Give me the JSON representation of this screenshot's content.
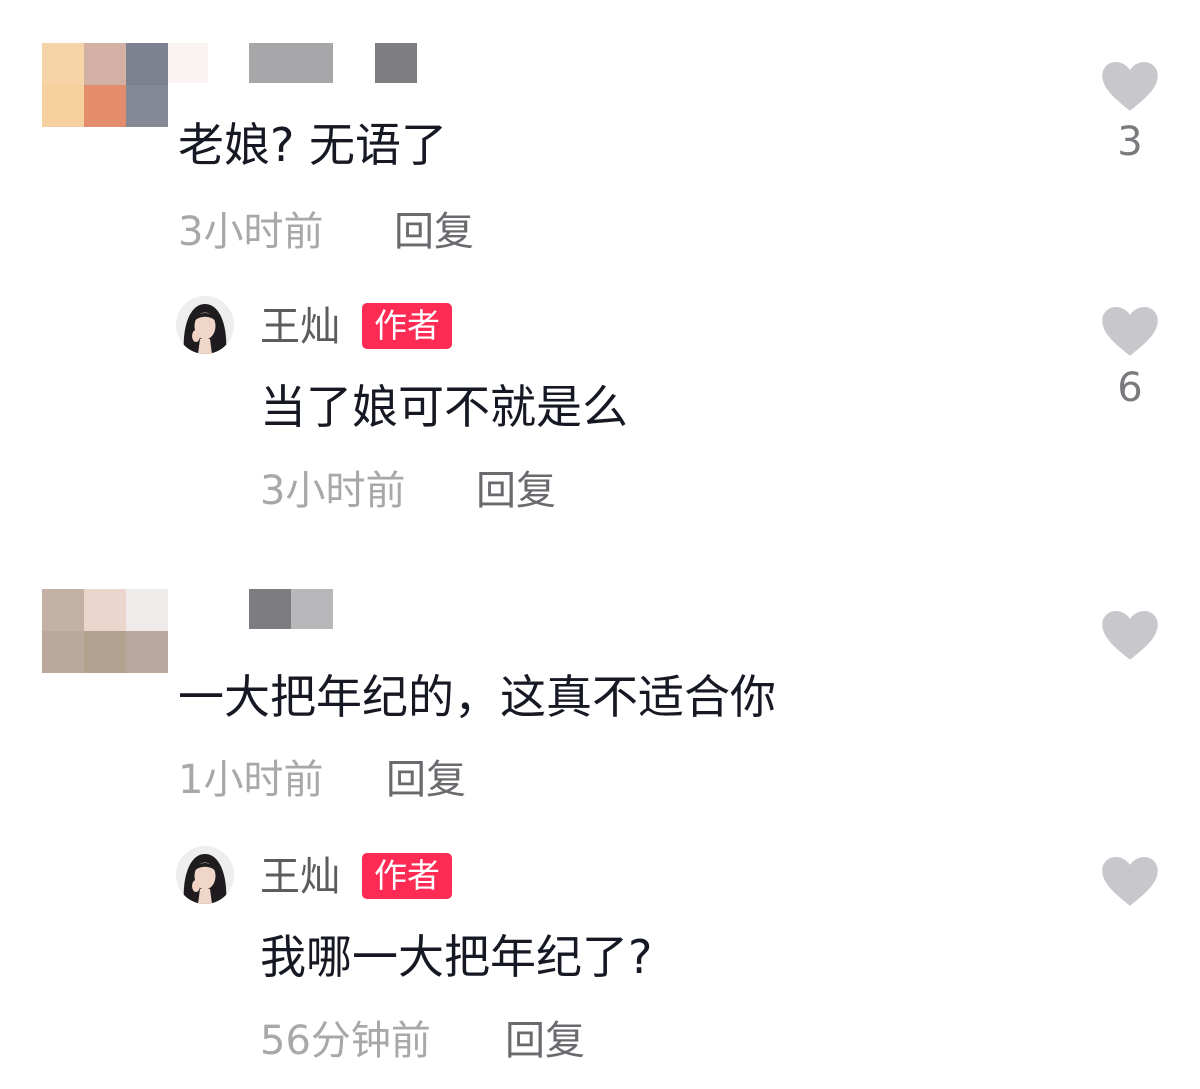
{
  "colors": {
    "badge": "#fe2c55",
    "heart": "#c8c8cc",
    "time": "#a8a8ab"
  },
  "comments": [
    {
      "text": "老娘? 无语了",
      "time": "3小时前",
      "reply_label": "回复",
      "likes": "3",
      "reply": {
        "username": "王灿",
        "badge": "作者",
        "text": "当了娘可不就是么",
        "time": "3小时前",
        "reply_label": "回复",
        "likes": "6"
      }
    },
    {
      "text": "一大把年纪的，这真不适合你",
      "time": "1小时前",
      "reply_label": "回复",
      "likes": "",
      "reply": {
        "username": "王灿",
        "badge": "作者",
        "text": "我哪一大把年纪了?",
        "time": "56分钟前",
        "reply_label": "回复",
        "likes": ""
      }
    }
  ]
}
